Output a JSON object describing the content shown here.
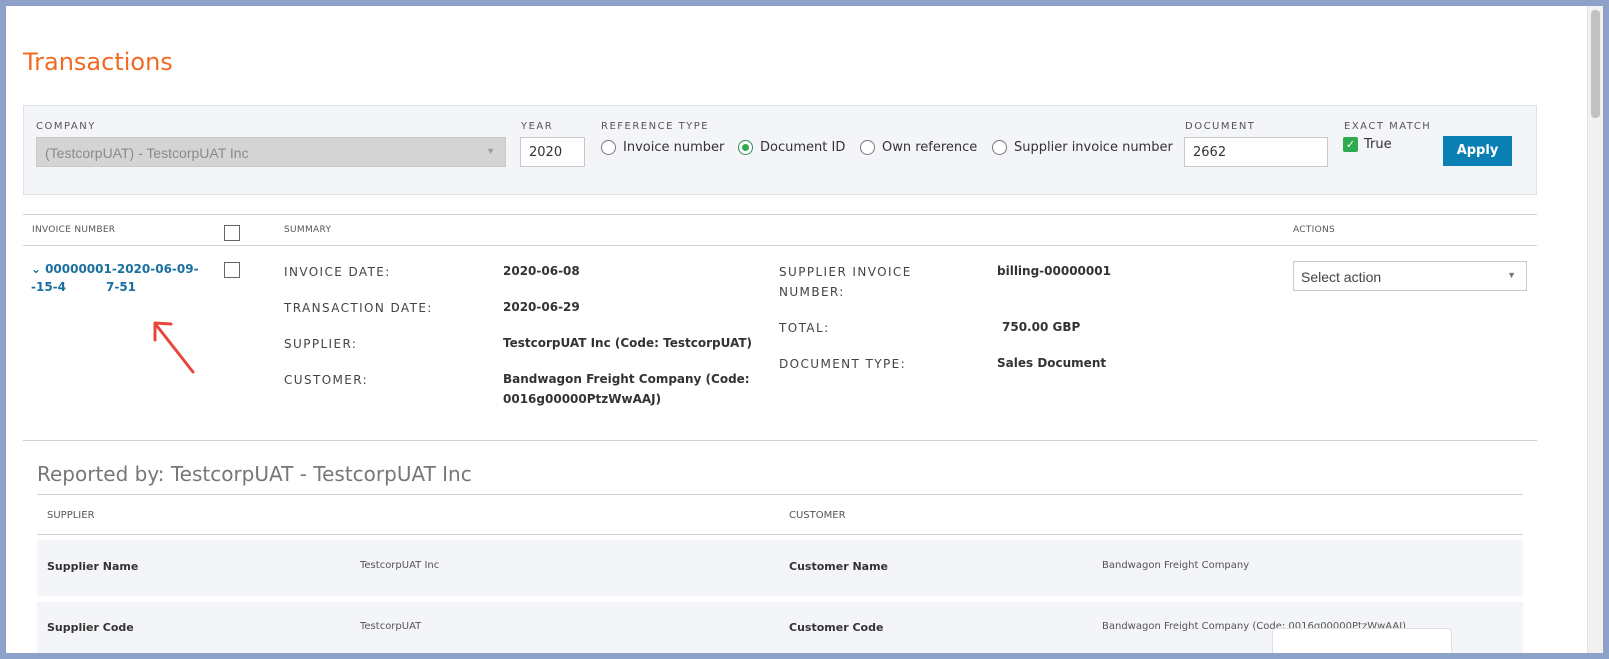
{
  "page": {
    "title": "Transactions"
  },
  "filters": {
    "company_label": "COMPANY",
    "company_value": "(TestcorpUAT) - TestcorpUAT Inc",
    "year_label": "YEAR",
    "year_value": "2020",
    "reftype_label": "REFERENCE TYPE",
    "radios": [
      {
        "label": "Invoice number",
        "selected": false
      },
      {
        "label": "Document ID",
        "selected": true
      },
      {
        "label": "Own reference",
        "selected": false
      },
      {
        "label": "Supplier invoice number",
        "selected": false
      }
    ],
    "document_label": "DOCUMENT",
    "document_value": "2662",
    "exact_label": "EXACT MATCH",
    "exact_value": "True",
    "exact_checked": true,
    "apply_label": "Apply"
  },
  "table": {
    "headers": {
      "invoice_number": "INVOICE NUMBER",
      "summary": "SUMMARY",
      "actions": "ACTIONS"
    },
    "row": {
      "invoice_number_line1": "00000001-2020-06-09--15-4",
      "invoice_number_line2": "7-51",
      "fields_left": [
        {
          "label": "INVOICE DATE:",
          "value": "2020-06-08"
        },
        {
          "label": "TRANSACTION DATE:",
          "value": "2020-06-29"
        },
        {
          "label": "SUPPLIER:",
          "value": "TestcorpUAT Inc (Code: TestcorpUAT)"
        },
        {
          "label": "CUSTOMER:",
          "value_line1": "Bandwagon Freight Company (Code:",
          "value_line2": "0016g00000PtzWwAAJ)"
        }
      ],
      "fields_right": [
        {
          "label_line1": "SUPPLIER INVOICE",
          "label_line2": "NUMBER:",
          "value": "billing-00000001"
        },
        {
          "label": "TOTAL:",
          "value": "750.00 GBP"
        },
        {
          "label": "DOCUMENT TYPE:",
          "value": "Sales Document"
        }
      ],
      "action_placeholder": "Select action"
    }
  },
  "reported": {
    "title": "Reported by: TestcorpUAT - TestcorpUAT Inc",
    "supplier_header": "SUPPLIER",
    "customer_header": "CUSTOMER",
    "rows": [
      {
        "s_label": "Supplier Name",
        "s_value": "TestcorpUAT Inc",
        "c_label": "Customer Name",
        "c_value": "Bandwagon Freight Company"
      },
      {
        "s_label": "Supplier Code",
        "s_value": "TestcorpUAT",
        "c_label": "Customer Code",
        "c_value": "Bandwagon Freight Company (Code: 0016g00000PtzWwAAJ)"
      }
    ]
  },
  "colors": {
    "accent": "#f26a21",
    "link": "#1a6fa0",
    "button": "#0a7fb4",
    "check": "#2eaa4f",
    "annotation_arrow": "#e8463a"
  },
  "icons": {
    "expand": "chevron-down-icon",
    "dropdown": "caret-down-icon",
    "annotation": "red-arrow-icon"
  }
}
